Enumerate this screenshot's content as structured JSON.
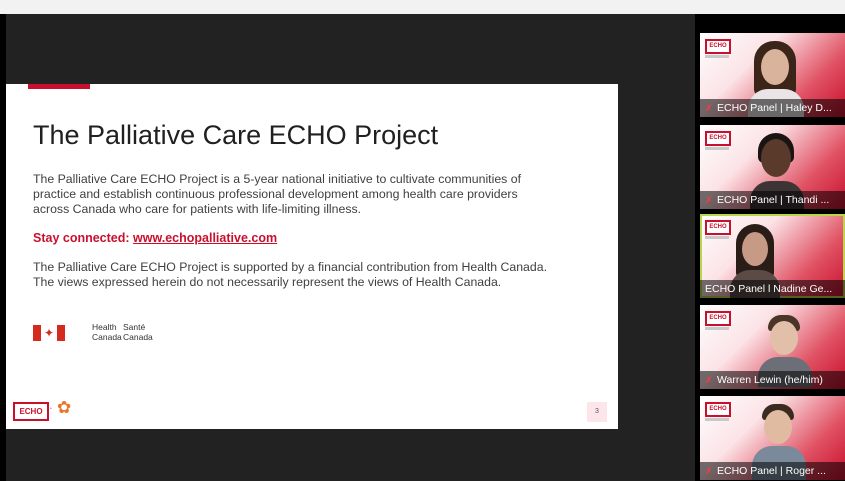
{
  "slide": {
    "title": "The Palliative Care ECHO Project",
    "paragraph1": "The Palliative Care ECHO Project is a 5-year national initiative to cultivate communities of practice and establish continuous professional development among health care providers across Canada who care for patients with life-limiting illness.",
    "stay_label": "Stay connected:",
    "stay_link": "www.echopalliative.com",
    "paragraph2": "The Palliative Care ECHO Project is supported by a financial contribution from Health Canada. The views expressed herein do not necessarily represent the views of Health Canada.",
    "gov_en": "Health\nCanada",
    "gov_fr": "Santé\nCanada",
    "echo_logo": "ECHO",
    "page_number": "3",
    "accent_color": "#c8102e"
  },
  "participants": [
    {
      "name": "ECHO Panel | Haley D...",
      "muted": true,
      "active": false
    },
    {
      "name": "ECHO Panel | Thandi ...",
      "muted": true,
      "active": false
    },
    {
      "name": "ECHO Panel l Nadine Ge...",
      "muted": false,
      "active": true
    },
    {
      "name": "Warren Lewin (he/him)",
      "muted": true,
      "active": false
    },
    {
      "name": "ECHO Panel | Roger ...",
      "muted": true,
      "active": false
    }
  ],
  "icons": {
    "muted_mic": "mic-off-icon",
    "flag": "canada-flag-icon"
  }
}
